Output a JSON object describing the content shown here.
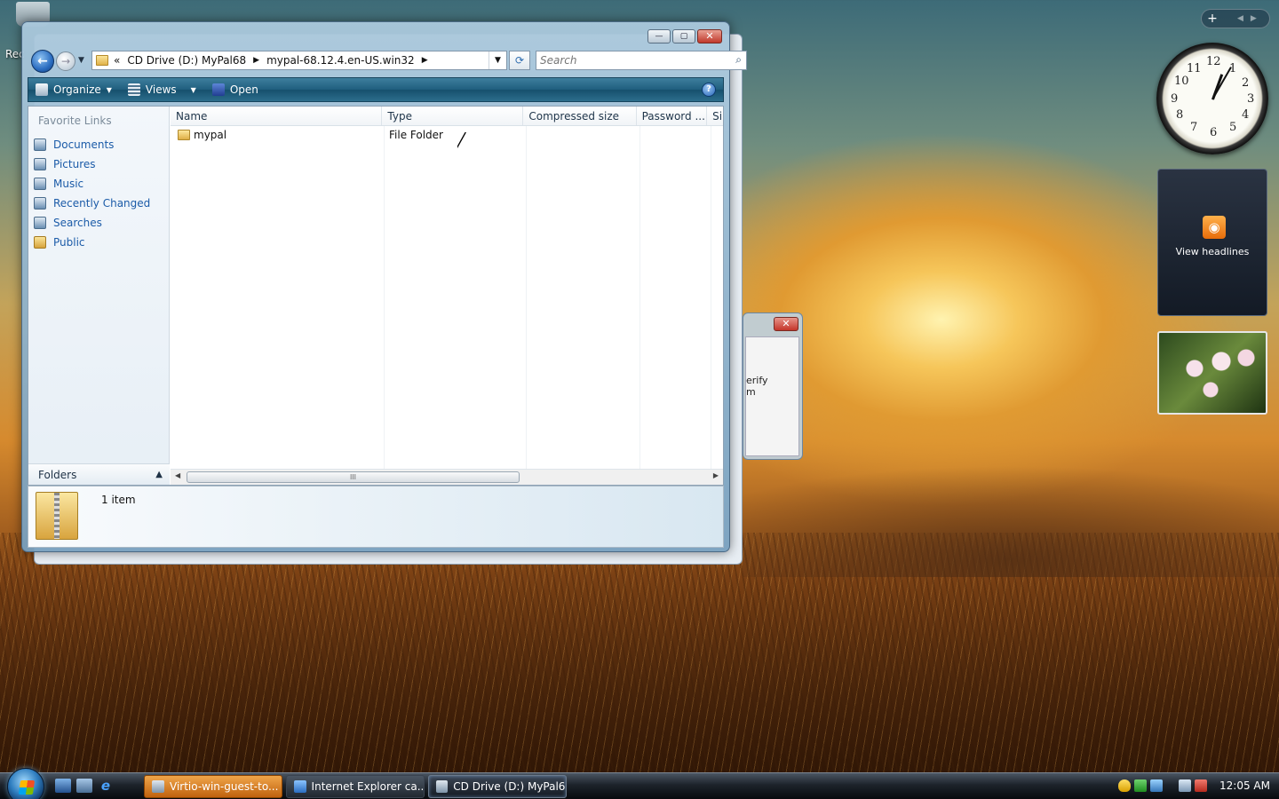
{
  "desktop": {
    "recycle_bin_label": "Rec",
    "dialog_text": "erify\nm",
    "dialog_close": "✕"
  },
  "explorer": {
    "caption": {
      "minimize": "—",
      "maximize": "▢",
      "close": "✕"
    },
    "nav": {
      "back": "←",
      "forward": "→",
      "history_dropdown": "▼"
    },
    "address": {
      "overflow": "«",
      "segments": [
        "CD Drive (D:) MyPal68",
        "mypal-68.12.4.en-US.win32"
      ],
      "dropdown": "▼",
      "refresh": "⟳"
    },
    "search": {
      "placeholder": "Search",
      "icon": "search-icon"
    },
    "toolbar": {
      "organize": "Organize",
      "views": "Views",
      "open": "Open",
      "help": "?"
    },
    "sidebar": {
      "title": "Favorite Links",
      "links": [
        {
          "label": "Documents",
          "icon": "documents-icon"
        },
        {
          "label": "Pictures",
          "icon": "pictures-icon"
        },
        {
          "label": "Music",
          "icon": "music-icon"
        },
        {
          "label": "Recently Changed",
          "icon": "recently-changed-icon"
        },
        {
          "label": "Searches",
          "icon": "searches-icon"
        },
        {
          "label": "Public",
          "icon": "folder-icon"
        }
      ],
      "folders_label": "Folders",
      "folders_chevron": "▲"
    },
    "columns": [
      "Name",
      "Type",
      "Compressed size",
      "Password ...",
      "Si"
    ],
    "rows": [
      {
        "name": "mypal",
        "type": "File Folder"
      }
    ],
    "scroll": {
      "left": "◀",
      "right": "▶",
      "grip": "III"
    },
    "status": {
      "count": "1 item"
    }
  },
  "gadgets": {
    "add": "+",
    "nav": "◀▶",
    "clock_numbers": [
      "12",
      "1",
      "2",
      "3",
      "4",
      "5",
      "6",
      "7",
      "8",
      "9",
      "10",
      "11"
    ],
    "feed_icon": "rss-icon",
    "feed_label": "View headlines"
  },
  "taskbar": {
    "tasks": [
      {
        "label": "Virtio-win-guest-to...",
        "state": "flash"
      },
      {
        "label": "Internet Explorer ca...",
        "state": "normal"
      },
      {
        "label": "CD Drive (D:) MyPal68",
        "state": "active"
      }
    ],
    "ie_glyph": "e",
    "time": "12:05 AM"
  },
  "colors": {
    "link": "#1b5ba8",
    "toolbar": "#1f5e7e",
    "task_flash": "#e0892c"
  }
}
